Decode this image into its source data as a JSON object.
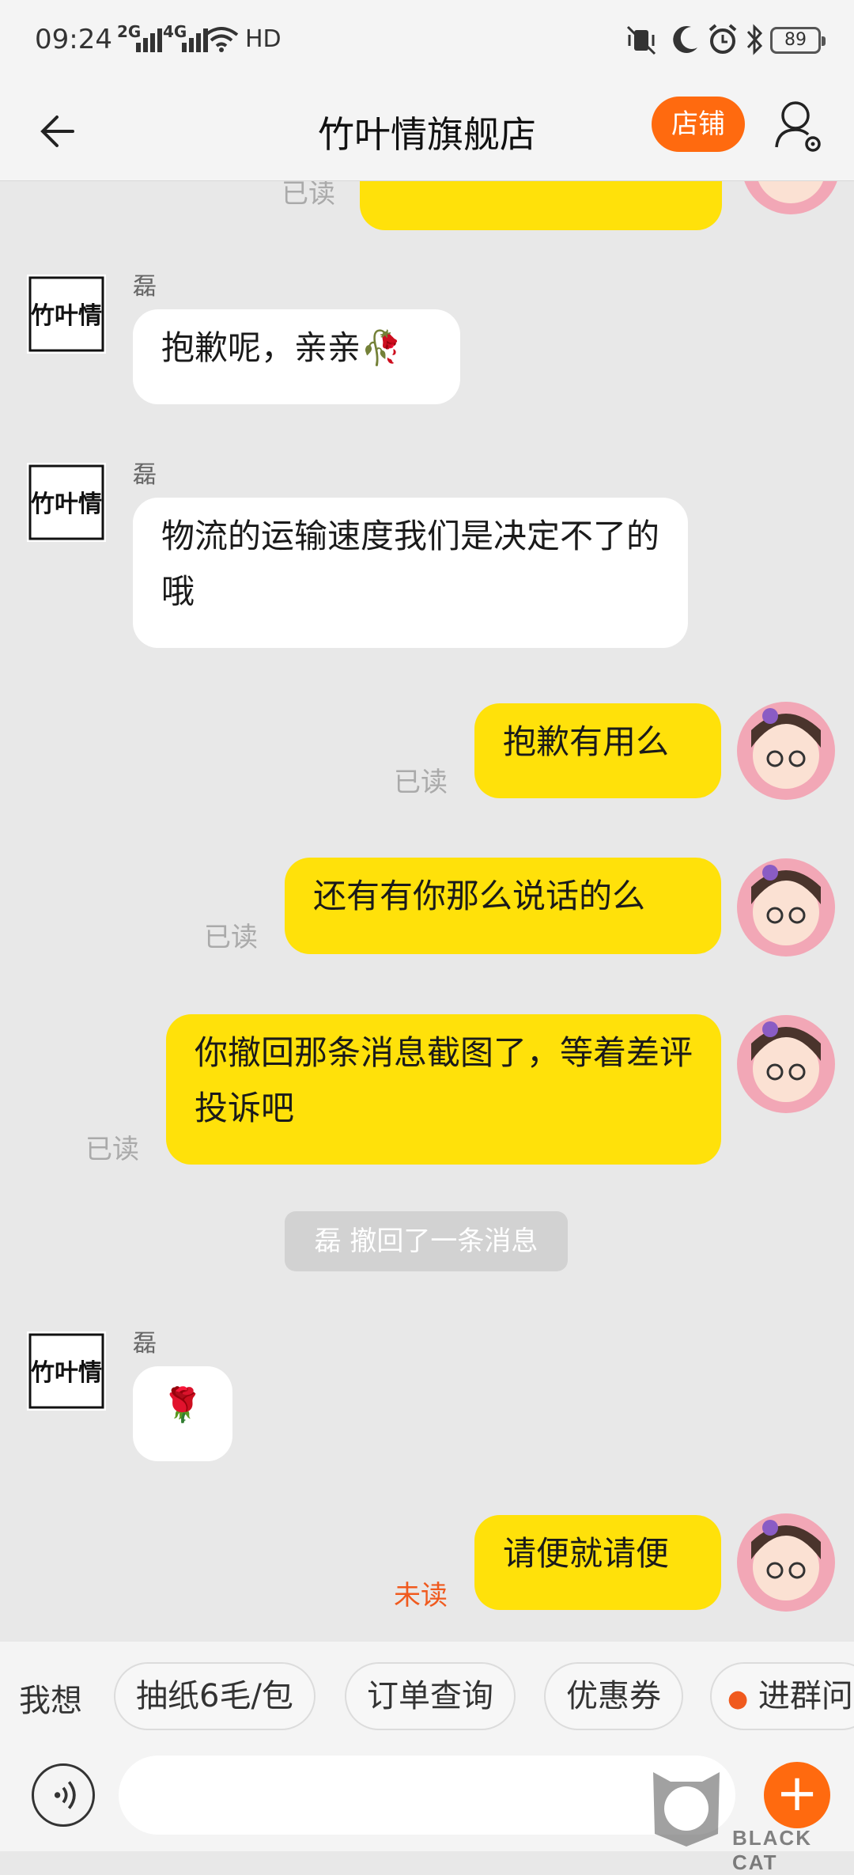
{
  "status_bar": {
    "time": "09:24",
    "signal_1": "2G",
    "signal_2": "4G",
    "network": "HD",
    "battery": "89"
  },
  "header": {
    "title": "竹叶情旗舰店",
    "shop_button": "店铺"
  },
  "messages": [
    {
      "side": "right",
      "text": "",
      "status": "已读"
    },
    {
      "side": "left",
      "sender": "磊",
      "text": "抱歉呢，亲亲🥀"
    },
    {
      "side": "left",
      "sender": "磊",
      "text": "物流的运输速度我们是决定不了的哦"
    },
    {
      "side": "right",
      "text": "抱歉有用么",
      "status": "已读"
    },
    {
      "side": "right",
      "text": "还有有你那么说话的么",
      "status": "已读"
    },
    {
      "side": "right",
      "text": "你撤回那条消息截图了，等着差评投诉吧",
      "status": "已读"
    },
    {
      "side": "system",
      "text": "磊 撤回了一条消息"
    },
    {
      "side": "left",
      "sender": "磊",
      "text": "🌹"
    },
    {
      "side": "right",
      "text": "请便就请便",
      "status": "未读"
    }
  ],
  "store_logo_text": "竹叶情",
  "quick_bar": {
    "label": "我想",
    "chips": [
      "抽纸6毛/包",
      "订单查询",
      "优惠券",
      "进群问"
    ]
  },
  "input": {
    "placeholder": ""
  },
  "watermark": "BLACK CAT",
  "colors": {
    "accent": "#ff6a0f",
    "bubble_self": "#ffe10a",
    "bubble_other": "#ffffff",
    "background": "#e8e8e8",
    "unread": "#f05a1e"
  }
}
